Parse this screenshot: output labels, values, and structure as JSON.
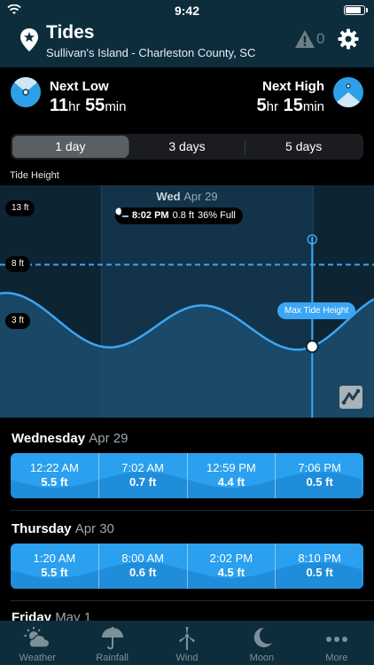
{
  "status": {
    "time": "9:42"
  },
  "header": {
    "title": "Tides",
    "subtitle": "Sullivan's Island - Charleston County, SC",
    "alert_count": "0",
    "accent": "#0d2d3c"
  },
  "next": {
    "low": {
      "label": "Next Low",
      "hours": "11",
      "minutes": "55",
      "hr_unit": "hr",
      "min_unit": "min"
    },
    "high": {
      "label": "Next High",
      "hours": "5",
      "minutes": "15",
      "hr_unit": "hr",
      "min_unit": "min"
    }
  },
  "range_tabs": [
    {
      "label": "1 day",
      "active": true
    },
    {
      "label": "3 days"
    },
    {
      "label": "5 days"
    }
  ],
  "chart_section_label": "Tide Height",
  "chart_data": {
    "type": "area",
    "day_label": "Wed",
    "day_date": "Apr 29",
    "y_tick_labels": [
      "13 ft",
      "8 ft",
      "3 ft"
    ],
    "y_ticks": [
      13,
      8,
      3
    ],
    "ylim": [
      -5.5,
      15
    ],
    "max_line_value": 8,
    "max_line_label": "Max Tide Height",
    "cursor": {
      "time": "8:02 PM",
      "height": "0.8 ft",
      "moon": "36% Full"
    },
    "x_hours_range": [
      0,
      24
    ],
    "series": [
      {
        "values": [
          {
            "x": 0.37,
            "y": 5.5
          },
          {
            "x": 7.03,
            "y": 0.7
          },
          {
            "x": 12.98,
            "y": 4.4
          },
          {
            "x": 19.1,
            "y": 0.5
          },
          {
            "x": 25.33,
            "y": 5.5
          }
        ]
      }
    ],
    "accent": "#3ba6f5"
  },
  "days": [
    {
      "name": "Wednesday",
      "date": "Apr 29",
      "tides": [
        {
          "time": "12:22 AM",
          "height": "5.5 ft"
        },
        {
          "time": "7:02 AM",
          "height": "0.7 ft"
        },
        {
          "time": "12:59 PM",
          "height": "4.4 ft"
        },
        {
          "time": "7:06 PM",
          "height": "0.5 ft"
        }
      ]
    },
    {
      "name": "Thursday",
      "date": "Apr 30",
      "tides": [
        {
          "time": "1:20 AM",
          "height": "5.5 ft"
        },
        {
          "time": "8:00 AM",
          "height": "0.6 ft"
        },
        {
          "time": "2:02 PM",
          "height": "4.5 ft"
        },
        {
          "time": "8:10 PM",
          "height": "0.5 ft"
        }
      ]
    },
    {
      "name": "Friday",
      "date": "May 1"
    }
  ],
  "tabs": [
    {
      "label": "Weather",
      "icon": "weather-icon"
    },
    {
      "label": "Rainfall",
      "icon": "umbrella-icon"
    },
    {
      "label": "Wind",
      "icon": "wind-turbine-icon"
    },
    {
      "label": "Moon",
      "icon": "moon-icon"
    },
    {
      "label": "More",
      "icon": "more-icon"
    }
  ]
}
